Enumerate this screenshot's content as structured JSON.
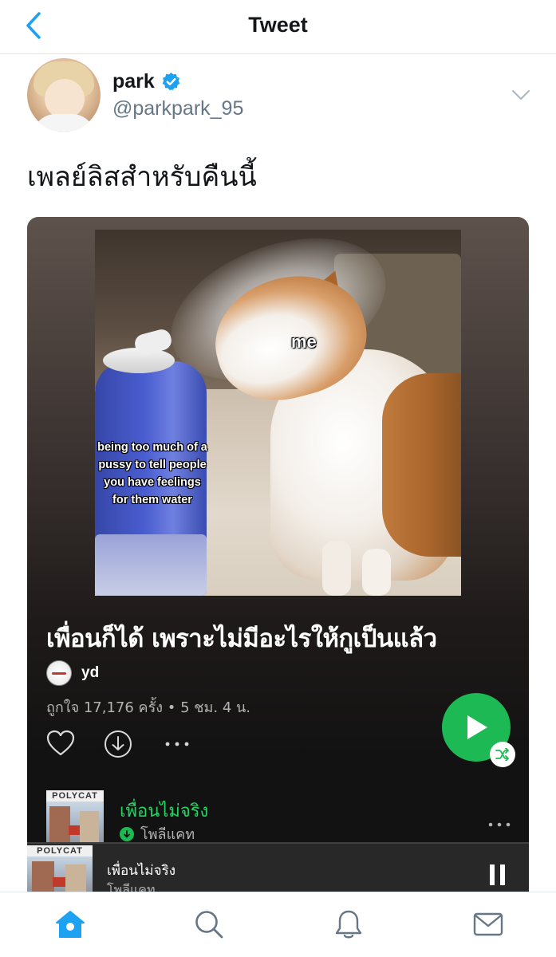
{
  "header": {
    "title": "Tweet"
  },
  "author": {
    "display_name": "park",
    "handle": "@parkpark_95"
  },
  "tweet": {
    "text": "เพลย์ลิสสำหรับคืนนี้"
  },
  "playlist": {
    "cover_text_top": "me",
    "cover_text_bottle": "being too much of a pussy to tell people you have feelings for them water",
    "title": "เพื่อนก็ได้ เพราะไม่มีอะไรให้กูเป็นแล้ว",
    "owner": "yd",
    "meta": "ถูกใจ 17,176 ครั้ง • 5 ชม. 4 น.",
    "more_label": "•••"
  },
  "track": {
    "title": "เพื่อนไม่จริง",
    "artist": "โพลีแคท",
    "art_text": "POLYCAT",
    "more_label": "•••"
  },
  "now_playing": {
    "title": "เพื่อนไม่จริง",
    "artist": "โพลีแคท",
    "art_text": "POLYCAT"
  },
  "colors": {
    "twitter_blue": "#1da1f2",
    "spotify_green": "#1db954",
    "verified_blue": "#1da1f2"
  },
  "tabbar": {
    "items": [
      "home-icon",
      "search-icon",
      "notifications-icon",
      "messages-icon"
    ],
    "active": "home-icon"
  }
}
